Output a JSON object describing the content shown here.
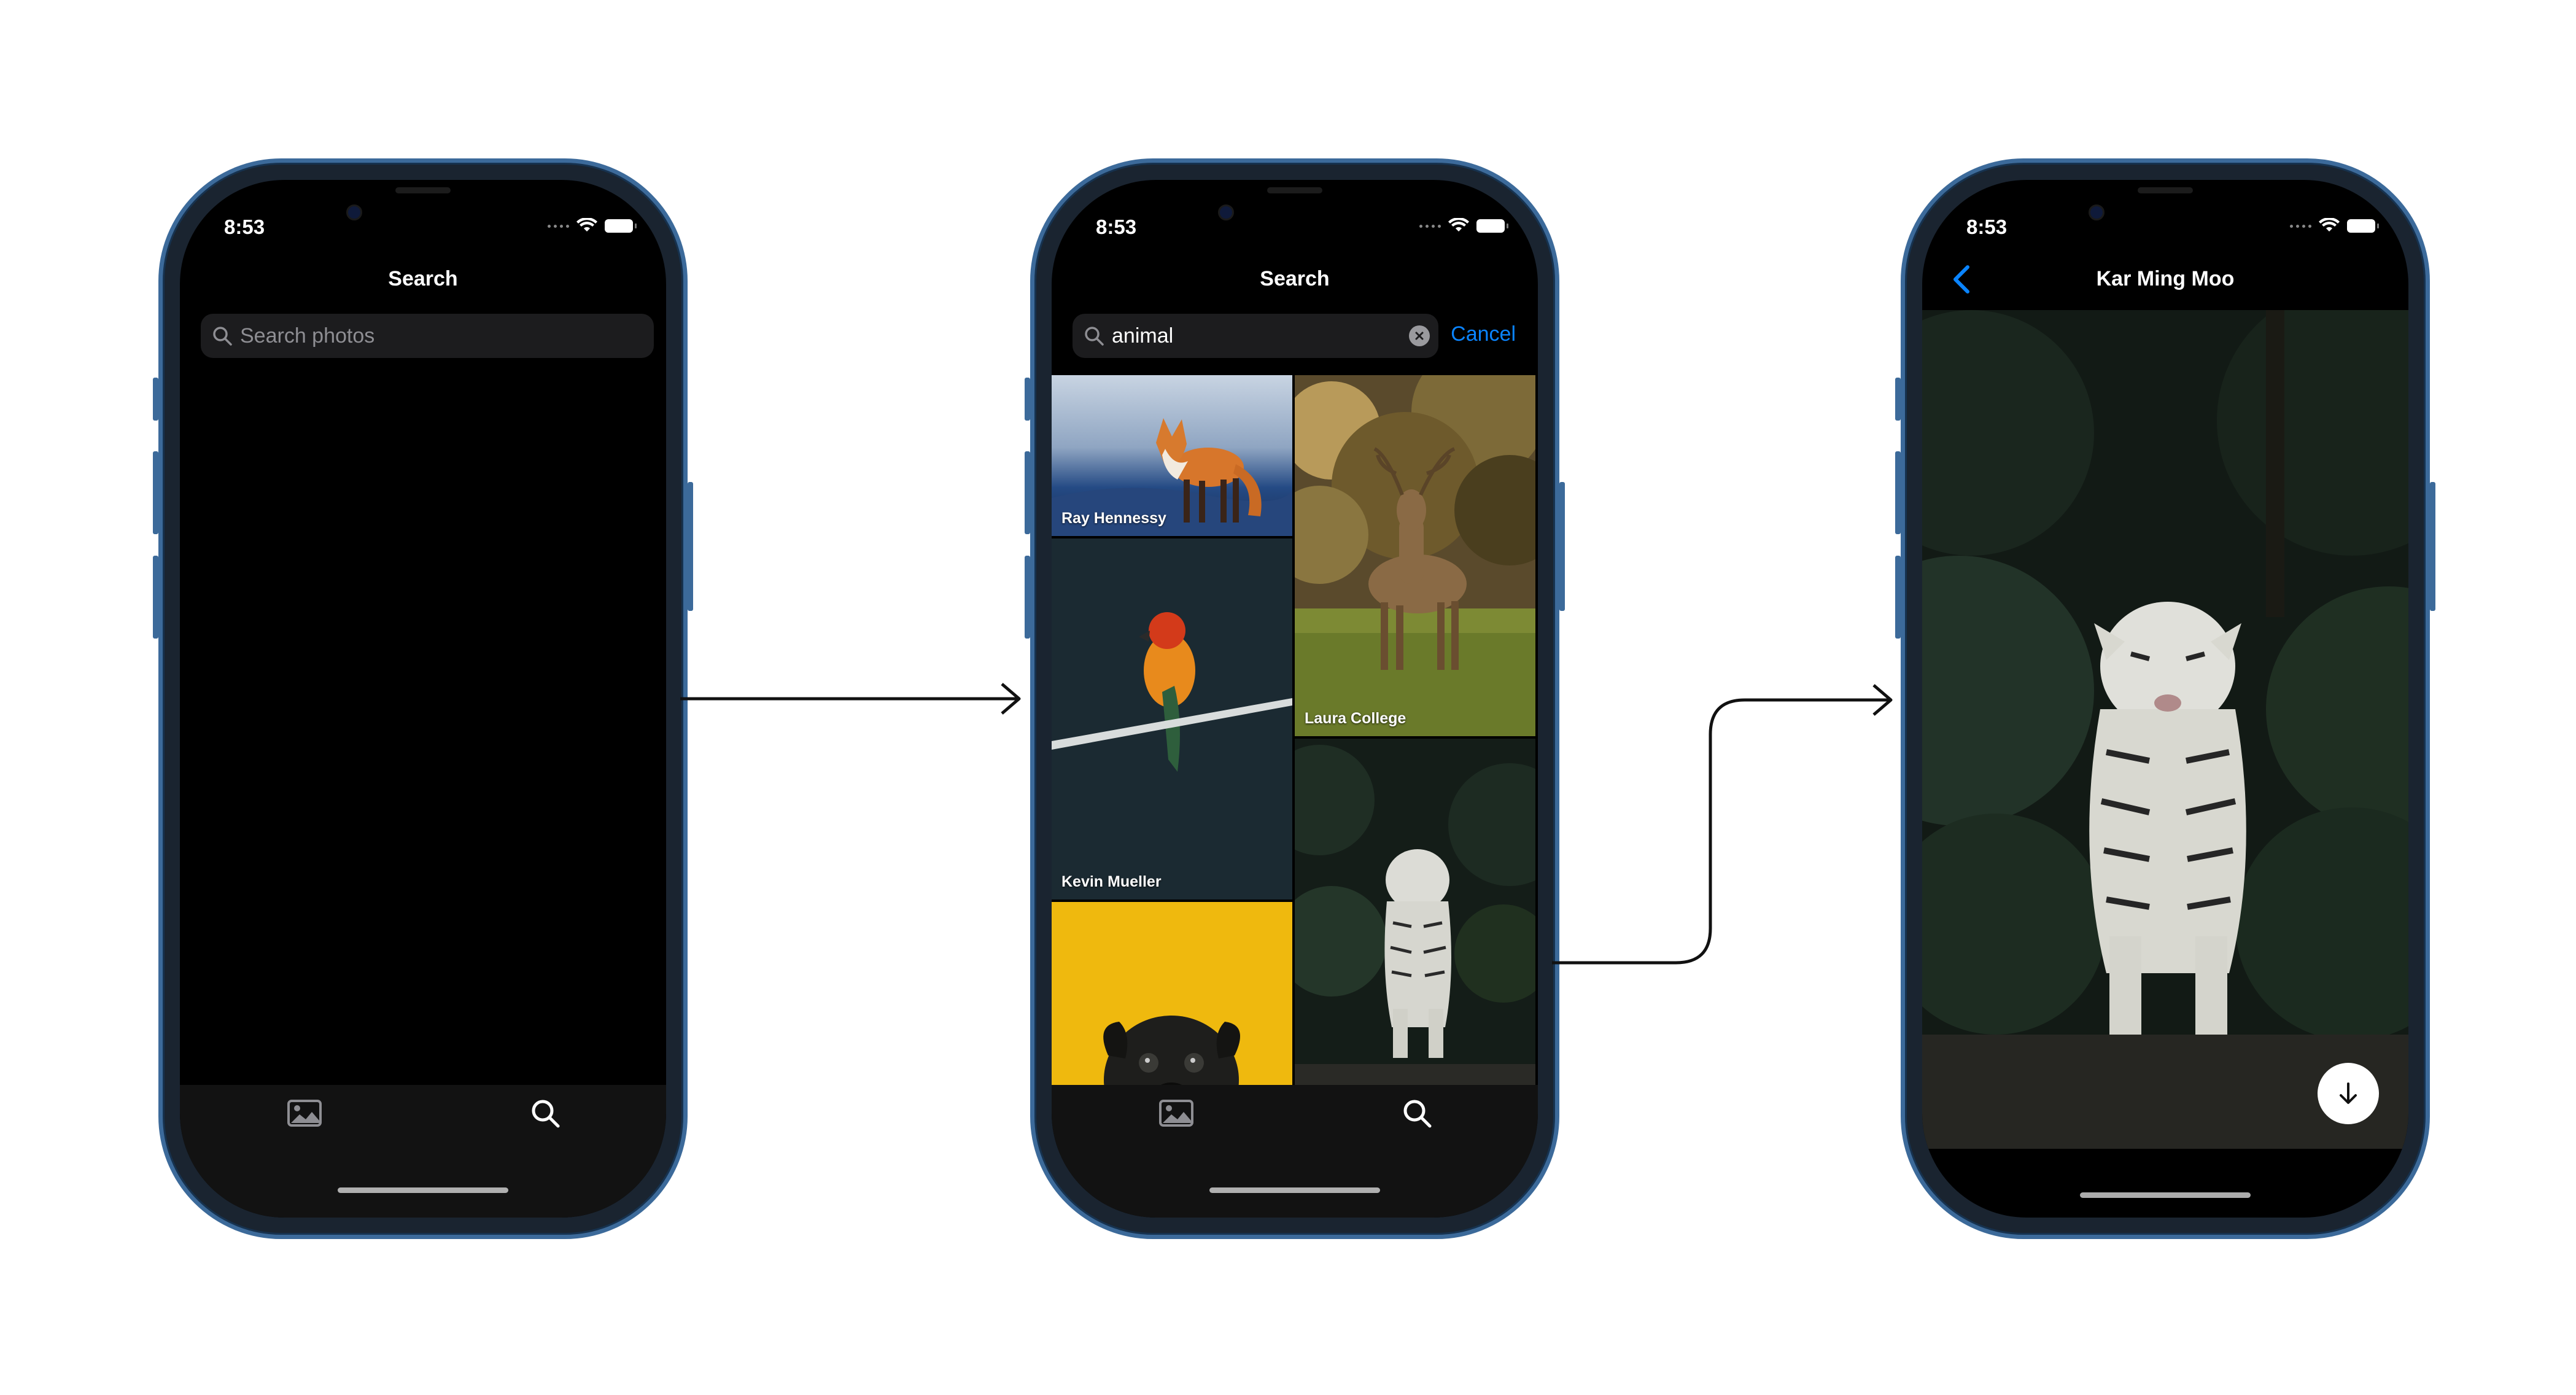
{
  "status": {
    "time": "8:53"
  },
  "screen1": {
    "title": "Search",
    "search_placeholder": "Search photos"
  },
  "screen2": {
    "title": "Search",
    "search_value": "animal",
    "cancel_label": "Cancel",
    "photos": [
      {
        "credit": "Ray Hennessy",
        "subject": "fox"
      },
      {
        "credit": "Laura College",
        "subject": "deer"
      },
      {
        "credit": "Kevin Mueller",
        "subject": "parrot"
      },
      {
        "credit": "",
        "subject": "tiger"
      },
      {
        "credit": "",
        "subject": "pug"
      }
    ]
  },
  "screen3": {
    "title": "Kar Ming Moo",
    "subject": "white tiger"
  },
  "tabs": [
    {
      "name": "photos",
      "icon": "photo-icon"
    },
    {
      "name": "search",
      "icon": "search-icon"
    }
  ],
  "colors": {
    "accent": "#0a84ff",
    "background": "#000000",
    "tabbar": "#121212",
    "frame": "#3c6a9a",
    "pug_background": "#f0b90f"
  }
}
